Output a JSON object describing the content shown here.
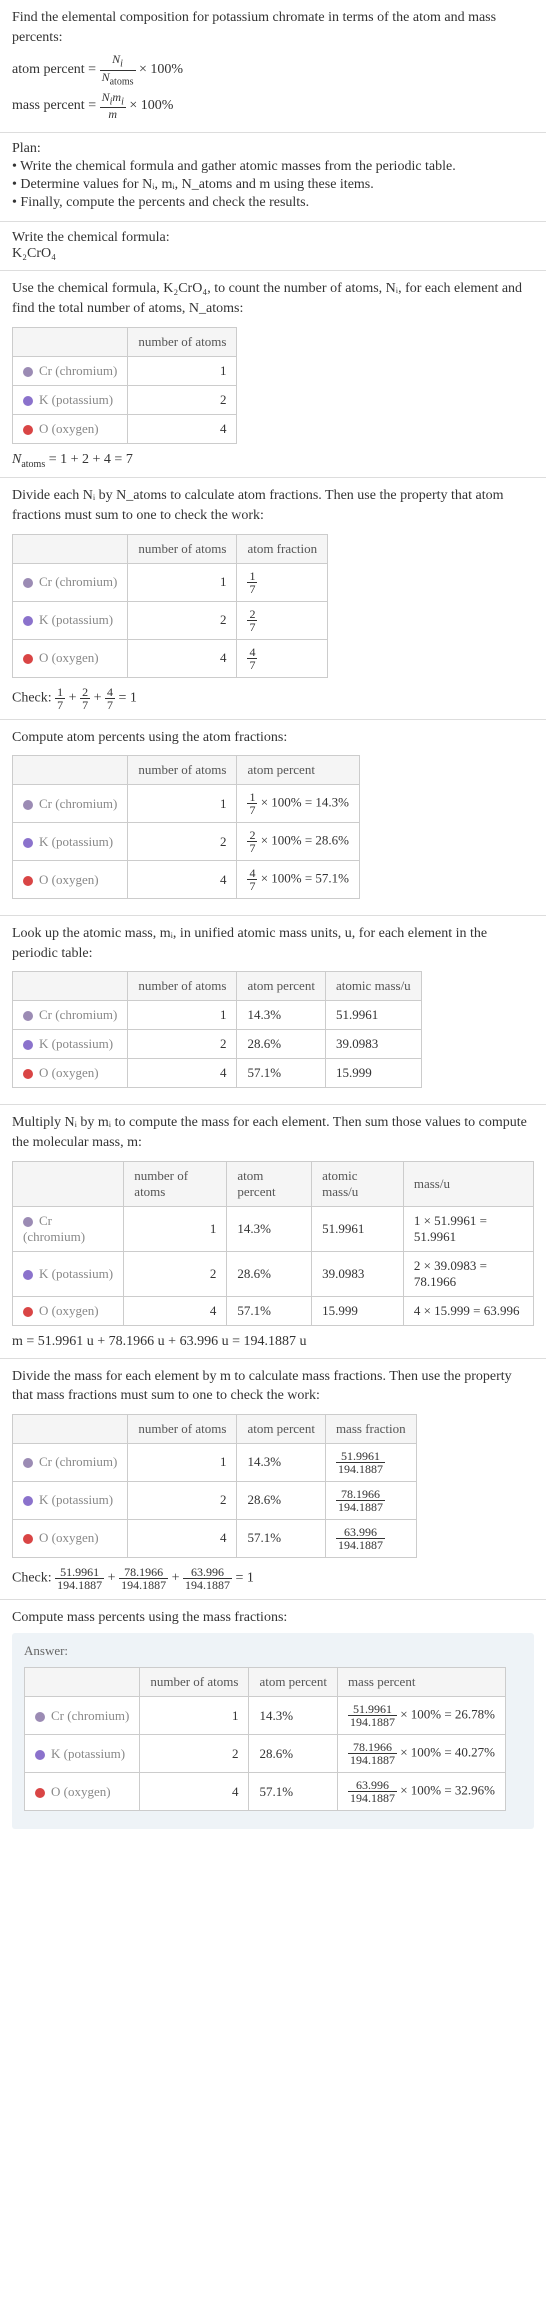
{
  "intro": {
    "line1": "Find the elemental composition for potassium chromate in terms of the atom and mass percents:",
    "atom_percent_formula": "atom percent = Nᵢ / N_atoms × 100%",
    "mass_percent_formula": "mass percent = Nᵢmᵢ / m × 100%"
  },
  "plan": {
    "title": "Plan:",
    "item1": "• Write the chemical formula and gather atomic masses from the periodic table.",
    "item2": "• Determine values for Nᵢ, mᵢ, N_atoms and m using these items.",
    "item3": "• Finally, compute the percents and check the results."
  },
  "formula_section": {
    "title": "Write the chemical formula:",
    "formula": "K₂CrO₄"
  },
  "count_section": {
    "intro": "Use the chemical formula, K₂CrO₄, to count the number of atoms, Nᵢ, for each element and find the total number of atoms, N_atoms:",
    "col_atoms": "number of atoms",
    "cr_label": "Cr (chromium)",
    "k_label": "K (potassium)",
    "o_label": "O (oxygen)",
    "cr_n": "1",
    "k_n": "2",
    "o_n": "4",
    "total": "N_atoms = 1 + 2 + 4 = 7"
  },
  "atom_frac_section": {
    "intro": "Divide each Nᵢ by N_atoms to calculate atom fractions. Then use the property that atom fractions must sum to one to check the work:",
    "col_atoms": "number of atoms",
    "col_frac": "atom fraction",
    "cr_n": "1",
    "cr_frac_num": "1",
    "cr_frac_den": "7",
    "k_n": "2",
    "k_frac_num": "2",
    "k_frac_den": "7",
    "o_n": "4",
    "o_frac_num": "4",
    "o_frac_den": "7",
    "check": "Check: 1/7 + 2/7 + 4/7 = 1"
  },
  "atom_pct_section": {
    "intro": "Compute atom percents using the atom fractions:",
    "col_atoms": "number of atoms",
    "col_pct": "atom percent",
    "cr_n": "1",
    "cr_pct": "1/7 × 100% = 14.3%",
    "k_n": "2",
    "k_pct": "2/7 × 100% = 28.6%",
    "o_n": "4",
    "o_pct": "4/7 × 100% = 57.1%"
  },
  "atomic_mass_section": {
    "intro": "Look up the atomic mass, mᵢ, in unified atomic mass units, u, for each element in the periodic table:",
    "col_atoms": "number of atoms",
    "col_pct": "atom percent",
    "col_mass": "atomic mass/u",
    "cr_n": "1",
    "cr_pct": "14.3%",
    "cr_mass": "51.9961",
    "k_n": "2",
    "k_pct": "28.6%",
    "k_mass": "39.0983",
    "o_n": "4",
    "o_pct": "57.1%",
    "o_mass": "15.999"
  },
  "mass_calc_section": {
    "intro": "Multiply Nᵢ by mᵢ to compute the mass for each element. Then sum those values to compute the molecular mass, m:",
    "col_atoms": "number of atoms",
    "col_pct": "atom percent",
    "col_amass": "atomic mass/u",
    "col_massu": "mass/u",
    "cr_n": "1",
    "cr_pct": "14.3%",
    "cr_amass": "51.9961",
    "cr_massu": "1 × 51.9961 = 51.9961",
    "k_n": "2",
    "k_pct": "28.6%",
    "k_amass": "39.0983",
    "k_massu": "2 × 39.0983 = 78.1966",
    "o_n": "4",
    "o_pct": "57.1%",
    "o_amass": "15.999",
    "o_massu": "4 × 15.999 = 63.996",
    "total": "m = 51.9961 u + 78.1966 u + 63.996 u = 194.1887 u"
  },
  "mass_frac_section": {
    "intro": "Divide the mass for each element by m to calculate mass fractions. Then use the property that mass fractions must sum to one to check the work:",
    "col_atoms": "number of atoms",
    "col_pct": "atom percent",
    "col_mfrac": "mass fraction",
    "cr_n": "1",
    "cr_pct": "14.3%",
    "cr_mf_num": "51.9961",
    "cr_mf_den": "194.1887",
    "k_n": "2",
    "k_pct": "28.6%",
    "k_mf_num": "78.1966",
    "k_mf_den": "194.1887",
    "o_n": "4",
    "o_pct": "57.1%",
    "o_mf_num": "63.996",
    "o_mf_den": "194.1887",
    "check": "Check: 51.9961/194.1887 + 78.1966/194.1887 + 63.996/194.1887 = 1"
  },
  "mass_pct_section": {
    "intro": "Compute mass percents using the mass fractions:",
    "answer_label": "Answer:",
    "col_atoms": "number of atoms",
    "col_pct": "atom percent",
    "col_mpct": "mass percent",
    "cr_n": "1",
    "cr_pct": "14.3%",
    "cr_mpct": "51.9961/194.1887 × 100% = 26.78%",
    "k_n": "2",
    "k_pct": "28.6%",
    "k_mpct": "78.1966/194.1887 × 100% = 40.27%",
    "o_n": "4",
    "o_pct": "57.1%",
    "o_mpct": "63.996/194.1887 × 100% = 32.96%"
  },
  "chart_data": {
    "type": "table",
    "title": "Elemental composition of potassium chromate (K₂CrO₄)",
    "elements": [
      {
        "symbol": "Cr",
        "name": "chromium",
        "atoms": 1,
        "atom_fraction": "1/7",
        "atom_percent": 14.3,
        "atomic_mass_u": 51.9961,
        "mass_u": 51.9961,
        "mass_fraction": "51.9961/194.1887",
        "mass_percent": 26.78
      },
      {
        "symbol": "K",
        "name": "potassium",
        "atoms": 2,
        "atom_fraction": "2/7",
        "atom_percent": 28.6,
        "atomic_mass_u": 39.0983,
        "mass_u": 78.1966,
        "mass_fraction": "78.1966/194.1887",
        "mass_percent": 40.27
      },
      {
        "symbol": "O",
        "name": "oxygen",
        "atoms": 4,
        "atom_fraction": "4/7",
        "atom_percent": 57.1,
        "atomic_mass_u": 15.999,
        "mass_u": 63.996,
        "mass_fraction": "63.996/194.1887",
        "mass_percent": 32.96
      }
    ],
    "N_atoms": 7,
    "molecular_mass_u": 194.1887
  }
}
